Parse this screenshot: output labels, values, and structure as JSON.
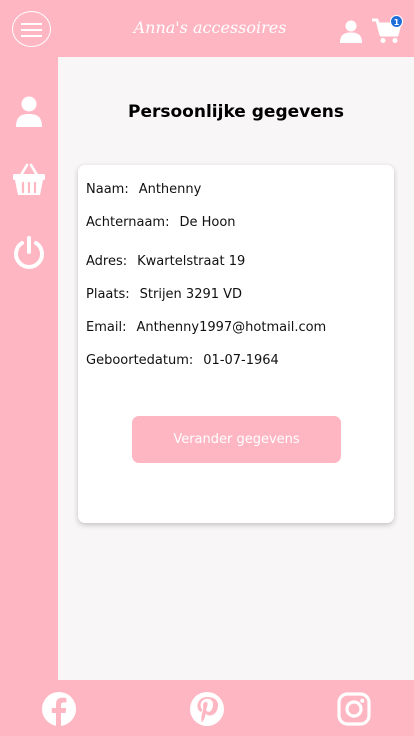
{
  "header": {
    "brand": "Anna's accessoires",
    "cart_count": "1"
  },
  "sidebar": {
    "items": [
      {
        "icon": "user-icon"
      },
      {
        "icon": "basket-icon"
      },
      {
        "icon": "power-icon"
      }
    ]
  },
  "main": {
    "title": "Persoonlijke gegevens",
    "fields": [
      {
        "label": "Naam:",
        "value": "Anthenny"
      },
      {
        "label": "Achternaam:",
        "value": "De Hoon"
      },
      {
        "label": "Adres:",
        "value": "Kwartelstraat 19"
      },
      {
        "label": "Plaats:",
        "value": "Strijen 3291 VD"
      },
      {
        "label": "Email:",
        "value": "Anthenny1997@hotmail.com"
      },
      {
        "label": "Geboortedatum:",
        "value": "01-07-1964"
      }
    ],
    "button_label": "Verander gegevens"
  },
  "footer": {
    "icons": [
      "facebook-icon",
      "pinterest-icon",
      "instagram-icon"
    ]
  },
  "colors": {
    "brand_pink": "#ffb6c3",
    "badge_blue": "#1e6fd9",
    "background": "#f8f6f7"
  }
}
